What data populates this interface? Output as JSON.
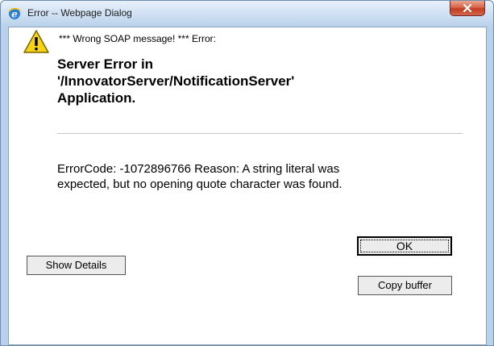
{
  "window": {
    "title": "Error -- Webpage Dialog",
    "close_label": "X"
  },
  "message": {
    "soap_text": "*** Wrong SOAP message! *** Error:",
    "title_lines": [
      "Server Error in",
      "'/InnovatorServer/NotificationServer'",
      "Application."
    ],
    "reason_lines": [
      "ErrorCode: -1072896766 Reason: A string literal was",
      "expected, but no opening quote character was found."
    ]
  },
  "buttons": {
    "ok_label": "OK",
    "show_details_label": "Show Details",
    "copy_buffer_label": "Copy buffer"
  },
  "icons": {
    "title_icon": "internet-explorer-icon",
    "close_icon": "close-icon",
    "message_icon": "warning-icon"
  },
  "colors": {
    "titlebar": "#bcd3ec",
    "close_button": "#c23b1f",
    "warning": "#f5d316",
    "content_background": "#ffffff"
  }
}
